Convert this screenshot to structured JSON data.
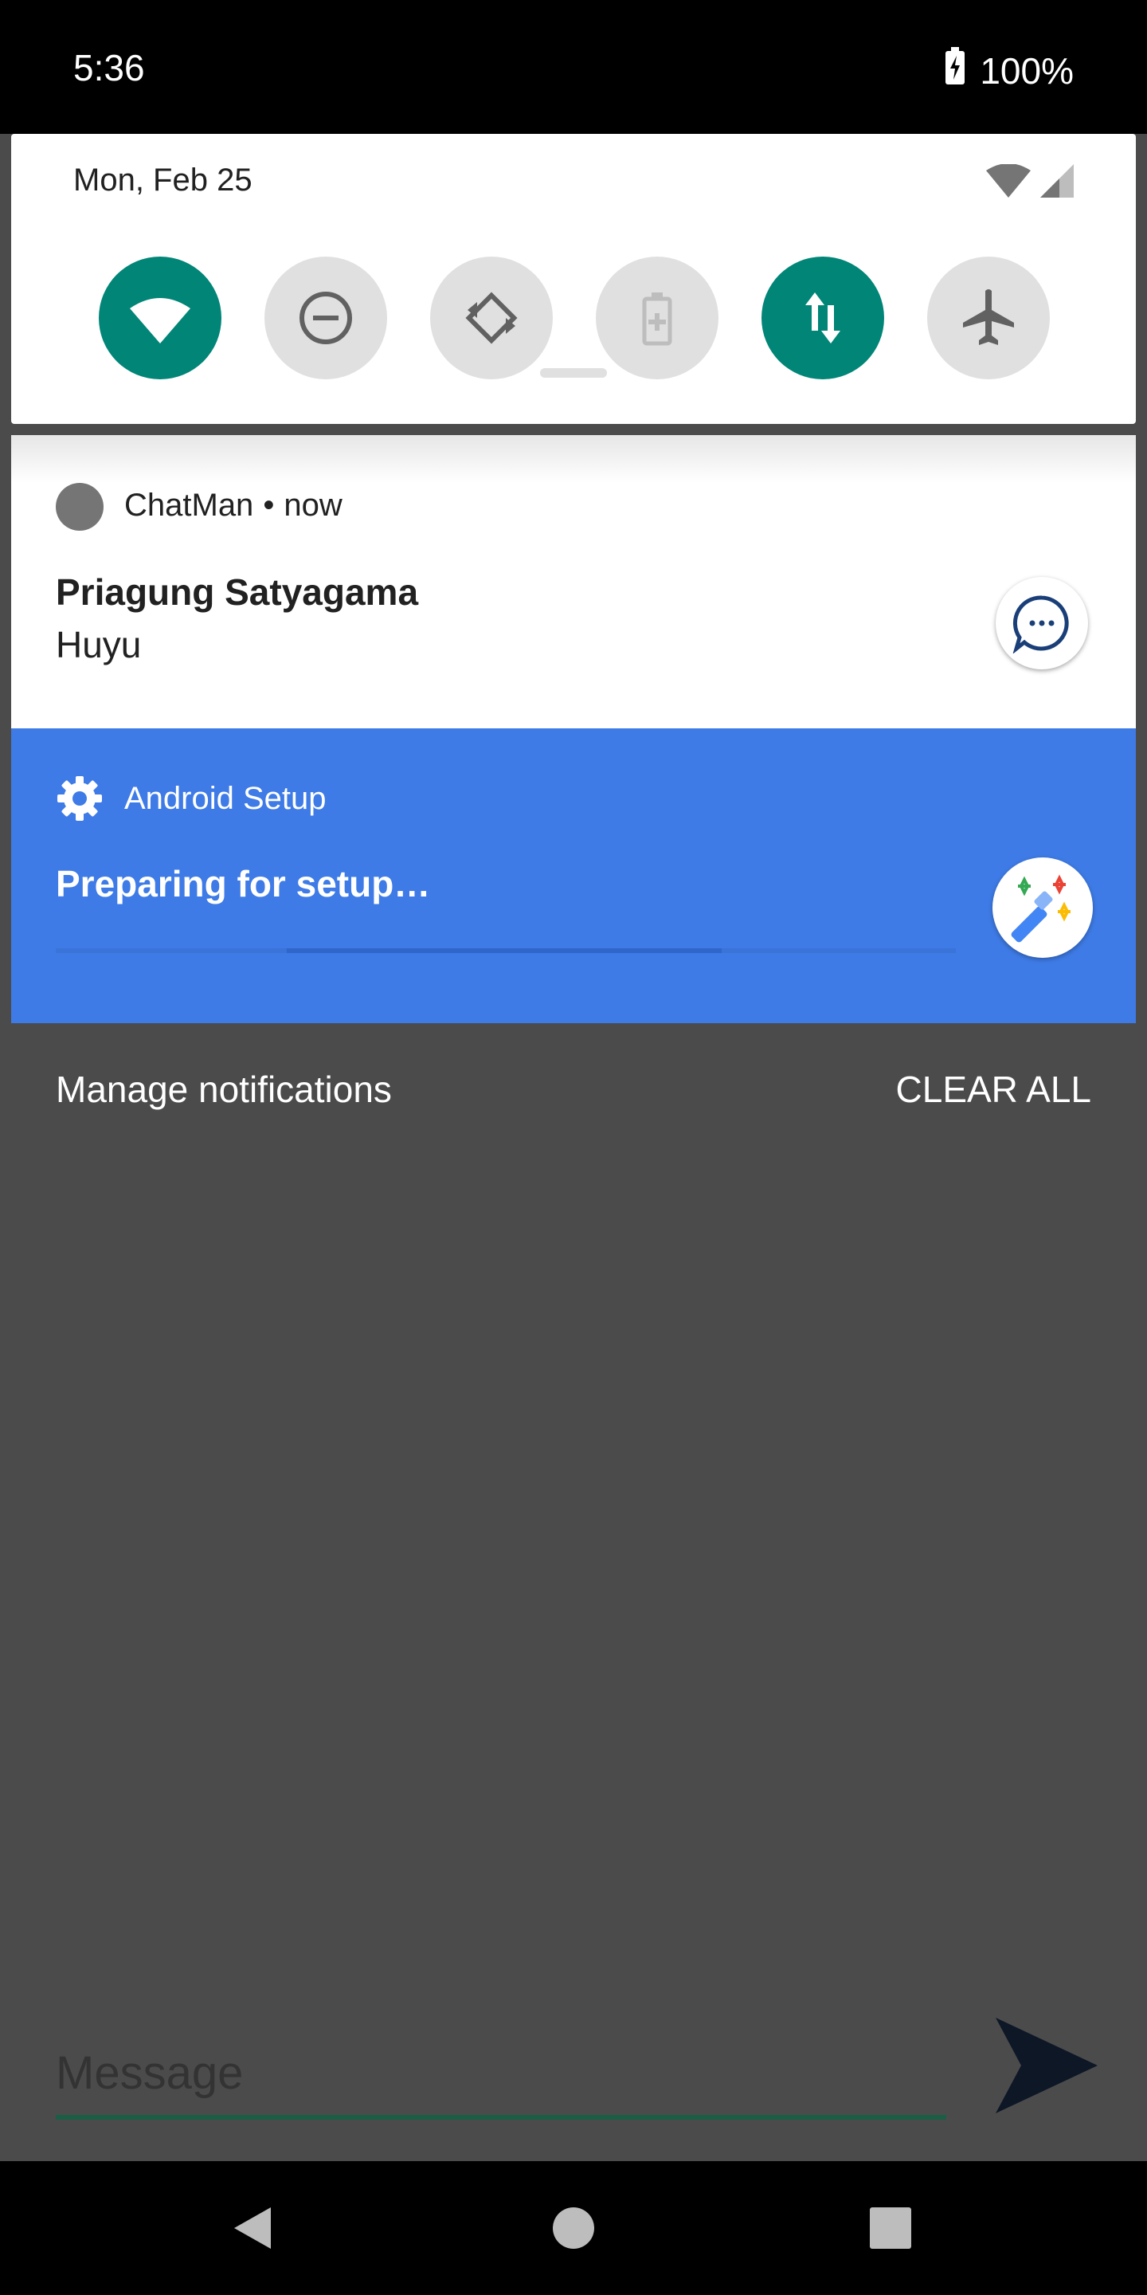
{
  "status_bar": {
    "time": "5:36",
    "battery": "100%"
  },
  "quick_settings": {
    "date": "Mon, Feb 25",
    "tiles": [
      {
        "name": "wifi",
        "state": "on"
      },
      {
        "name": "do-not-disturb",
        "state": "off"
      },
      {
        "name": "auto-rotate",
        "state": "off"
      },
      {
        "name": "battery-saver",
        "state": "off"
      },
      {
        "name": "mobile-data",
        "state": "on"
      },
      {
        "name": "airplane-mode",
        "state": "off"
      }
    ],
    "accent_on": "#008577"
  },
  "notifications": {
    "peek_text": "Priagung Satyagama",
    "chat": {
      "app_name": "ChatMan",
      "separator": "•",
      "time": "now",
      "title": "Priagung Satyagama",
      "body": "Huyu"
    },
    "setup": {
      "app_name": "Android Setup",
      "title": "Preparing for setup…",
      "background": "#3e7be6"
    }
  },
  "footer": {
    "manage_label": "Manage notifications",
    "clear_label": "CLEAR ALL"
  },
  "composer": {
    "placeholder": "Message"
  }
}
